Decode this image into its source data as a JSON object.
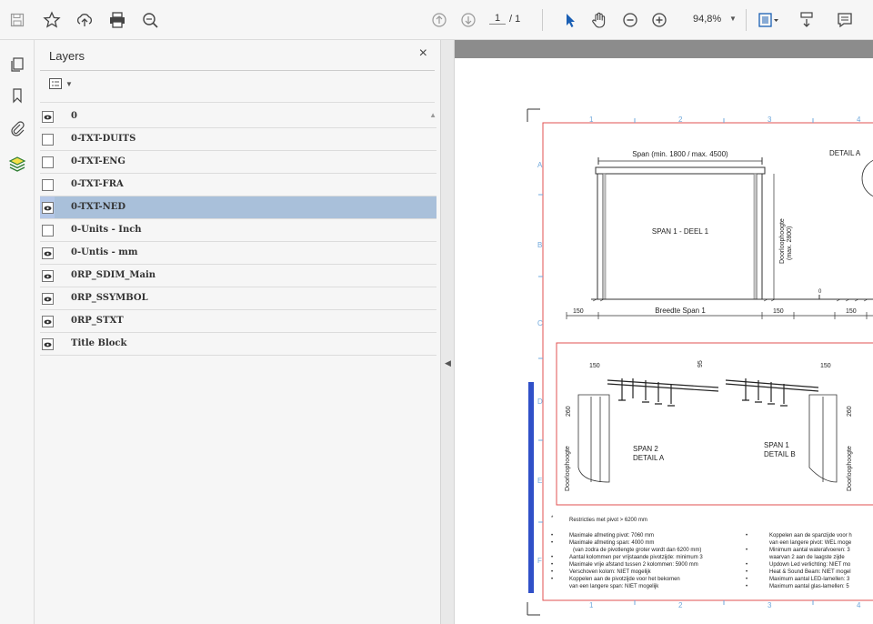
{
  "toolbar": {
    "page_current": "1",
    "page_total": "/ 1",
    "zoom": "94,8%"
  },
  "icons": [
    "save-icon",
    "star-icon",
    "upload-icon",
    "print-icon",
    "search-zoom-icon",
    "page-up-icon",
    "page-down-icon",
    "select-arrow-icon",
    "hand-icon",
    "zoom-out-icon",
    "zoom-in-icon",
    "fit-page-icon",
    "scroll-mode-icon",
    "comment-icon"
  ],
  "panel": {
    "title": "Layers",
    "close": "×"
  },
  "layers": [
    {
      "name": "0",
      "visible": true
    },
    {
      "name": "0-TXT-DUITS",
      "visible": false
    },
    {
      "name": "0-TXT-ENG",
      "visible": false
    },
    {
      "name": "0-TXT-FRA",
      "visible": false
    },
    {
      "name": "0-TXT-NED",
      "visible": true,
      "selected": true
    },
    {
      "name": "0-Units - Inch",
      "visible": false
    },
    {
      "name": "0-Untis - mm",
      "visible": true
    },
    {
      "name": "0RP_SDIM_Main",
      "visible": true
    },
    {
      "name": "0RP_SSYMBOL",
      "visible": true
    },
    {
      "name": "0RP_STXT",
      "visible": true
    },
    {
      "name": "Title Block",
      "visible": true
    }
  ],
  "drawing": {
    "col_labels": [
      "1",
      "2",
      "3",
      "4"
    ],
    "row_labels": [
      "A",
      "B",
      "C",
      "D",
      "E",
      "F"
    ],
    "span_dim": "Span (min. 1800 / max. 4500)",
    "detail_a": "DETAIL A",
    "span_label": "SPAN 1 - DEEL 1",
    "height_label_1": "Doorloophoogte",
    "height_label_2": "(max. 2800)",
    "width_label": "Breedte Span 1",
    "dim_150": "150",
    "dim_0": "0",
    "dim_95": "95",
    "dim_260": "260",
    "span2_line1": "SPAN 2",
    "span2_line2": "DETAIL A",
    "span1_line1": "SPAN 1",
    "span1_line2": "DETAIL B",
    "door_label": "Doorloophoogte",
    "restriction": "Restricties met pivot > 6200 mm",
    "notes_left": [
      "Maximale afmeting pivot: 7060 mm",
      "Maximale afmeting span: 4000 mm",
      "(van zodra de pivotlengte groter wordt dan 6200 mm)",
      "Aantal kolommen per vrijstaande pivotzijde: minimum 3",
      "Maximale vrije afstand tussen 2 kolommen: 5900 mm",
      "Verschoven kolom: NIET mogelijk",
      "Koppelen aan de pivotzijde voor het bekomen",
      "van een langere span: NIET mogelijk"
    ],
    "notes_right": [
      "Koppelen aan de spanzijde voor h",
      "van een langere pivot: WEL moge",
      "Minimum aantal waterafvoeren: 3",
      "waarvan 2 aan de laagste zijde",
      "Updown Led verlichting: NIET mo",
      "Heat & Sound Beam: NIET mogel",
      "Maximum aantal LED-lamellen: 3",
      "Maximum aantal glas-lamellen: 5"
    ]
  }
}
